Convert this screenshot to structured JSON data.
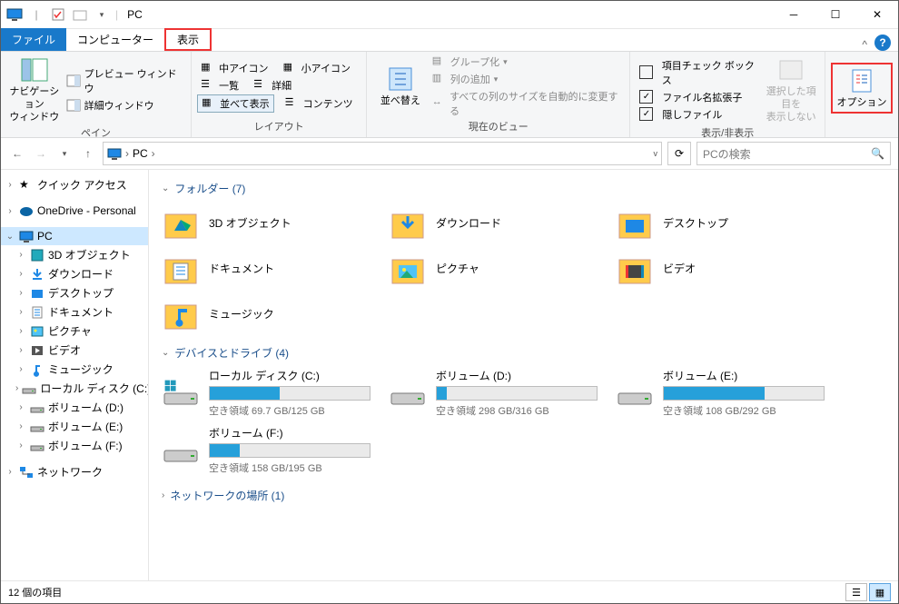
{
  "title": "PC",
  "tabs": {
    "file": "ファイル",
    "computer": "コンピューター",
    "view": "表示"
  },
  "ribbon": {
    "pane": {
      "nav": "ナビゲーション\nウィンドウ",
      "preview": "プレビュー ウィンドウ",
      "details": "詳細ウィンドウ",
      "label": "ペイン"
    },
    "layout": {
      "medium": "中アイコン",
      "small": "小アイコン",
      "list": "一覧",
      "details": "詳細",
      "tiles": "並べて表示",
      "content": "コンテンツ",
      "label": "レイアウト"
    },
    "sort": "並べ替え",
    "view": {
      "group": "グループ化",
      "addcol": "列の追加",
      "autosize": "すべての列のサイズを自動的に変更する",
      "label": "現在のビュー"
    },
    "showhide": {
      "chk": "項目チェック ボックス",
      "ext": "ファイル名拡張子",
      "hidden": "隠しファイル",
      "hidebtn": "選択した項目を\n表示しない",
      "label": "表示/非表示"
    },
    "options": "オプション"
  },
  "addr": {
    "pc": "PC",
    "searchPlaceholder": "PCの検索"
  },
  "tree": {
    "quick": "クイック アクセス",
    "onedrive": "OneDrive - Personal",
    "pc": "PC",
    "pcchildren": [
      "3D オブジェクト",
      "ダウンロード",
      "デスクトップ",
      "ドキュメント",
      "ピクチャ",
      "ビデオ",
      "ミュージック",
      "ローカル ディスク (C:)",
      "ボリューム (D:)",
      "ボリューム (E:)",
      "ボリューム (F:)"
    ],
    "network": "ネットワーク"
  },
  "folders": {
    "header": "フォルダー (7)",
    "items": [
      "3D オブジェクト",
      "ダウンロード",
      "デスクトップ",
      "ドキュメント",
      "ピクチャ",
      "ビデオ",
      "ミュージック"
    ]
  },
  "drives": {
    "header": "デバイスとドライブ (4)",
    "items": [
      {
        "name": "ローカル ディスク (C:)",
        "sub": "空き領域 69.7 GB/125 GB",
        "fill": 44
      },
      {
        "name": "ボリューム (D:)",
        "sub": "空き領域 298 GB/316 GB",
        "fill": 6
      },
      {
        "name": "ボリューム (E:)",
        "sub": "空き領域 108 GB/292 GB",
        "fill": 63
      },
      {
        "name": "ボリューム (F:)",
        "sub": "空き領域 158 GB/195 GB",
        "fill": 19
      }
    ]
  },
  "network": {
    "header": "ネットワークの場所 (1)"
  },
  "status": "12 個の項目"
}
